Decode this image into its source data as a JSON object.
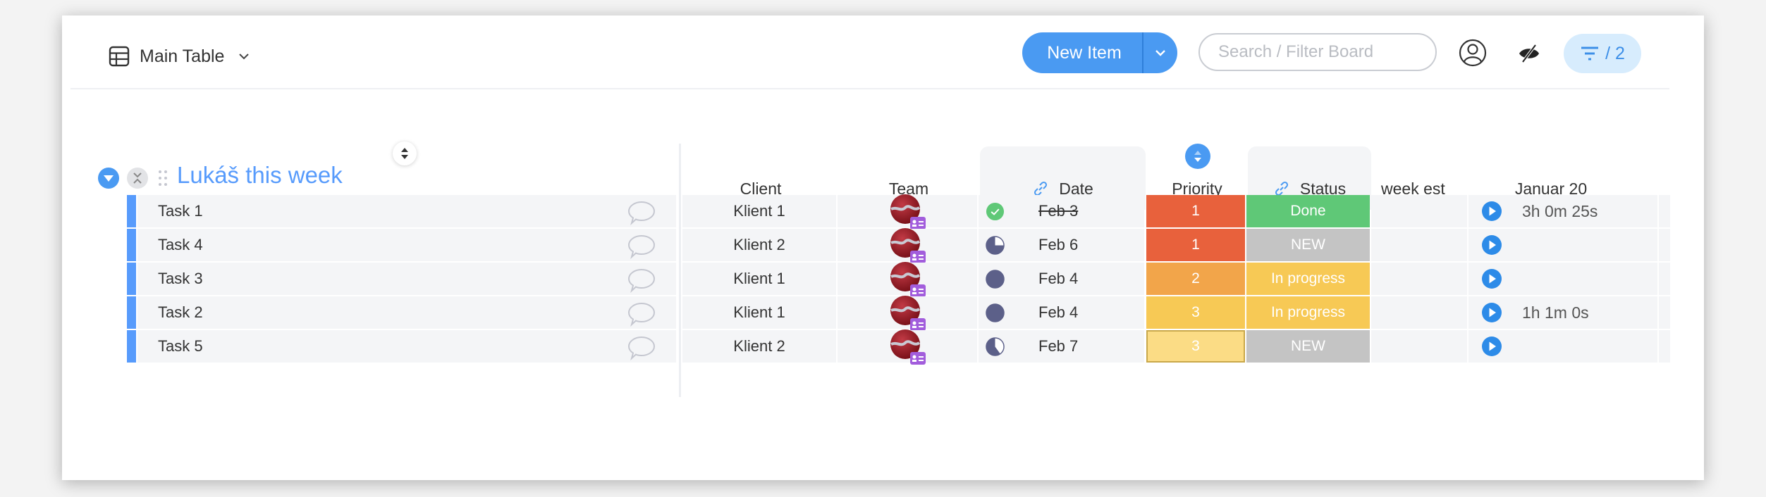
{
  "toolbar": {
    "view_icon": "table-icon",
    "view_label": "Main Table",
    "view_chevron_icon": "chevron-down-icon",
    "new_item_label": "New Item",
    "new_item_dropdown_icon": "chevron-down-icon",
    "search_placeholder": "Search / Filter Board",
    "search_value": "",
    "person_filter_icon": "person-circle-icon",
    "hide_columns_icon": "eye-slash-icon",
    "filter_icon": "filter-icon",
    "filter_count": "/ 2"
  },
  "colors": {
    "accent": "#579bfc",
    "primary_button": "#4a9af2",
    "row_bg": "#f4f5f7",
    "priority_1": "#e8613c",
    "priority_2": "#f2a54a",
    "priority_3": "#f7c955",
    "priority_3_light": "#fbdc85",
    "status_done": "#5fc877",
    "status_new": "#c4c4c4",
    "status_in_progress": "#f7c955",
    "date_done": "#5fc877",
    "date_pending": "#5c6089",
    "avatar_badge": "#a25ddc"
  },
  "group": {
    "title": "Lukáš this week",
    "collapse_icon": "caret-down-circle-icon",
    "collapse_all_icon": "collapse-arrows-icon",
    "drag_icon": "drag-handle-icon"
  },
  "columns": [
    {
      "key": "client",
      "label": "Client"
    },
    {
      "key": "team",
      "label": "Team"
    },
    {
      "key": "date",
      "label": "Date",
      "icon": "link-icon"
    },
    {
      "key": "priority",
      "label": "Priority"
    },
    {
      "key": "status",
      "label": "Status",
      "icon": "link-icon"
    },
    {
      "key": "week_est",
      "label": "week est"
    },
    {
      "key": "timer",
      "label": "Januar 20"
    }
  ],
  "rows": [
    {
      "name": "Task 1",
      "client": "Klient 1",
      "team_icon": "team-avatar",
      "date": "Feb 3",
      "date_state": "done",
      "date_progress": 1.0,
      "priority": "1",
      "priority_color": "#e8613c",
      "status": "Done",
      "status_color": "#5fc877",
      "week_est": "",
      "timer": "3h 0m 25s"
    },
    {
      "name": "Task 4",
      "client": "Klient 2",
      "team_icon": "team-avatar",
      "date": "Feb 6",
      "date_state": "pending",
      "date_progress": 0.75,
      "priority": "1",
      "priority_color": "#e8613c",
      "status": "NEW",
      "status_color": "#c4c4c4",
      "week_est": "",
      "timer": ""
    },
    {
      "name": "Task 3",
      "client": "Klient 1",
      "team_icon": "team-avatar",
      "date": "Feb 4",
      "date_state": "pending",
      "date_progress": 1.0,
      "priority": "2",
      "priority_color": "#f2a54a",
      "status": "In progress",
      "status_color": "#f7c955",
      "week_est": "",
      "timer": ""
    },
    {
      "name": "Task 2",
      "client": "Klient 1",
      "team_icon": "team-avatar",
      "date": "Feb 4",
      "date_state": "pending",
      "date_progress": 1.0,
      "priority": "3",
      "priority_color": "#f7c955",
      "status": "In progress",
      "status_color": "#f7c955",
      "week_est": "",
      "timer": "1h 1m 0s"
    },
    {
      "name": "Task 5",
      "client": "Klient 2",
      "team_icon": "team-avatar",
      "date": "Feb 7",
      "date_state": "pending",
      "date_progress": 0.6,
      "priority": "3",
      "priority_color": "#fbdc85",
      "status": "NEW",
      "status_color": "#c4c4c4",
      "week_est": "",
      "timer": ""
    }
  ]
}
